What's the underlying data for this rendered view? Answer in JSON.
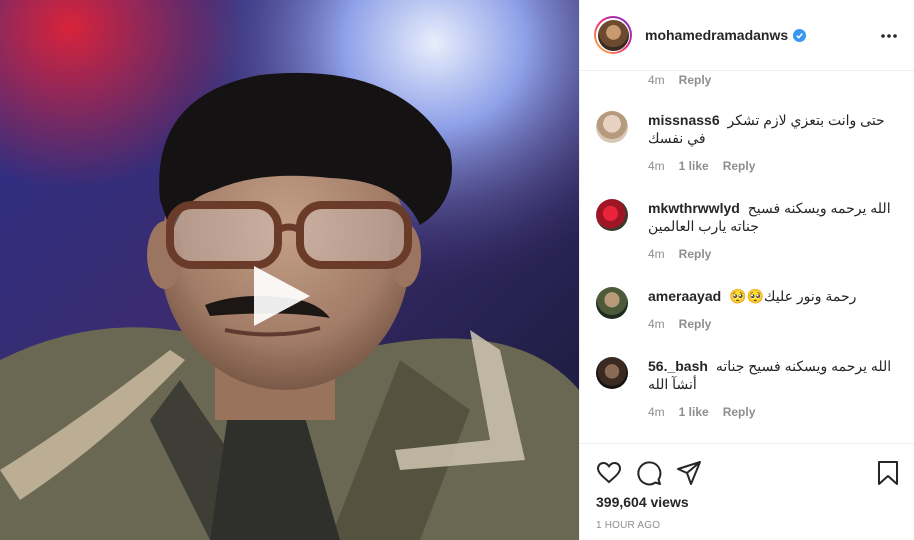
{
  "post": {
    "username": "mohamedramadanws",
    "verified": true,
    "media_type": "video"
  },
  "comments": [
    {
      "username": "",
      "text": "",
      "time": "4m",
      "likes": "",
      "reply_label": "Reply"
    },
    {
      "username": "missnass6",
      "text": "حتى وانت بتعزي لازم تشكر في نفسك",
      "time": "4m",
      "likes": "1 like",
      "reply_label": "Reply"
    },
    {
      "username": "mkwthrwwlyd",
      "text": "الله يرحمه ويسكنه فسيح جناته يارب العالمين",
      "time": "4m",
      "likes": "",
      "reply_label": "Reply"
    },
    {
      "username": "ameraayad",
      "text": "رحمة ونور عليك🥺🥺",
      "time": "4m",
      "likes": "",
      "reply_label": "Reply"
    },
    {
      "username": "56._bash",
      "text": "الله يرحمه ويسكنه فسيح جناته أنشآ الله",
      "time": "4m",
      "likes": "1 like",
      "reply_label": "Reply"
    }
  ],
  "footer": {
    "views": "399,604 views",
    "time_ago": "1 HOUR AGO"
  },
  "icons": {
    "like": "heart-icon",
    "comment": "comment-icon",
    "share": "share-icon",
    "save": "bookmark-icon",
    "more": "more-options-icon",
    "play": "play-icon"
  },
  "colors": {
    "verified_blue": "#3897f0",
    "text": "#262626",
    "secondary": "#8e8e8e"
  }
}
